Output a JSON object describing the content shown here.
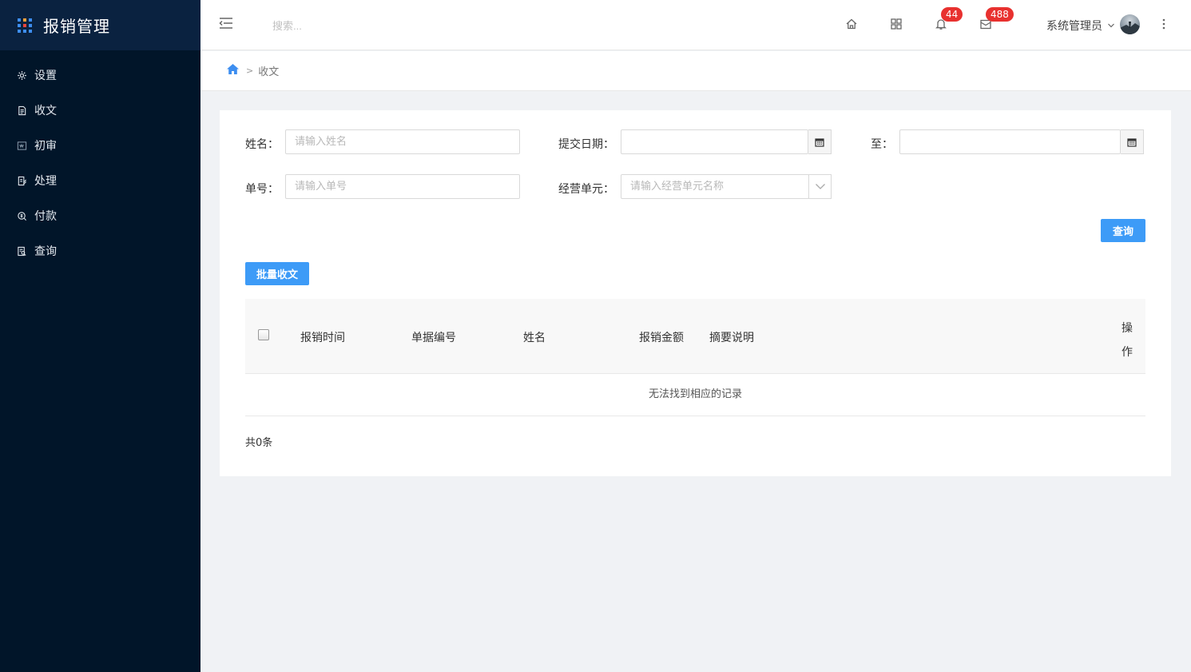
{
  "app": {
    "title": "报销管理"
  },
  "sidebar": {
    "items": [
      {
        "label": "设置",
        "icon": "gear-icon"
      },
      {
        "label": "收文",
        "icon": "document-icon"
      },
      {
        "label": "初审",
        "icon": "review-icon"
      },
      {
        "label": "处理",
        "icon": "edit-doc-icon"
      },
      {
        "label": "付款",
        "icon": "payment-icon"
      },
      {
        "label": "查询",
        "icon": "search-doc-icon"
      }
    ]
  },
  "header": {
    "search_placeholder": "搜索...",
    "notifications_count": "44",
    "messages_count": "488",
    "user_name": "系统管理员"
  },
  "breadcrumb": {
    "separator": ">",
    "current": "收文"
  },
  "filters": {
    "name_label": "姓名：",
    "name_placeholder": "请输入姓名",
    "date_label": "提交日期：",
    "date_from_value": "",
    "to_label": "至：",
    "date_to_value": "",
    "order_label": "单号：",
    "order_placeholder": "请输入单号",
    "unit_label": "经营单元：",
    "unit_placeholder": "请输入经营单元名称",
    "query_button": "查询"
  },
  "actions": {
    "batch_button": "批量收文"
  },
  "table": {
    "columns": [
      "报销时间",
      "单据编号",
      "姓名",
      "报销金额",
      "摘要说明"
    ],
    "op_column": [
      "操",
      "作"
    ],
    "empty_text": "无法找到相应的记录",
    "total_text": "共0条"
  },
  "colors": {
    "sidebar_bg": "#011529",
    "brand_bg": "#0a2240",
    "primary": "#3d9bf7",
    "badge": "#e8312f"
  }
}
